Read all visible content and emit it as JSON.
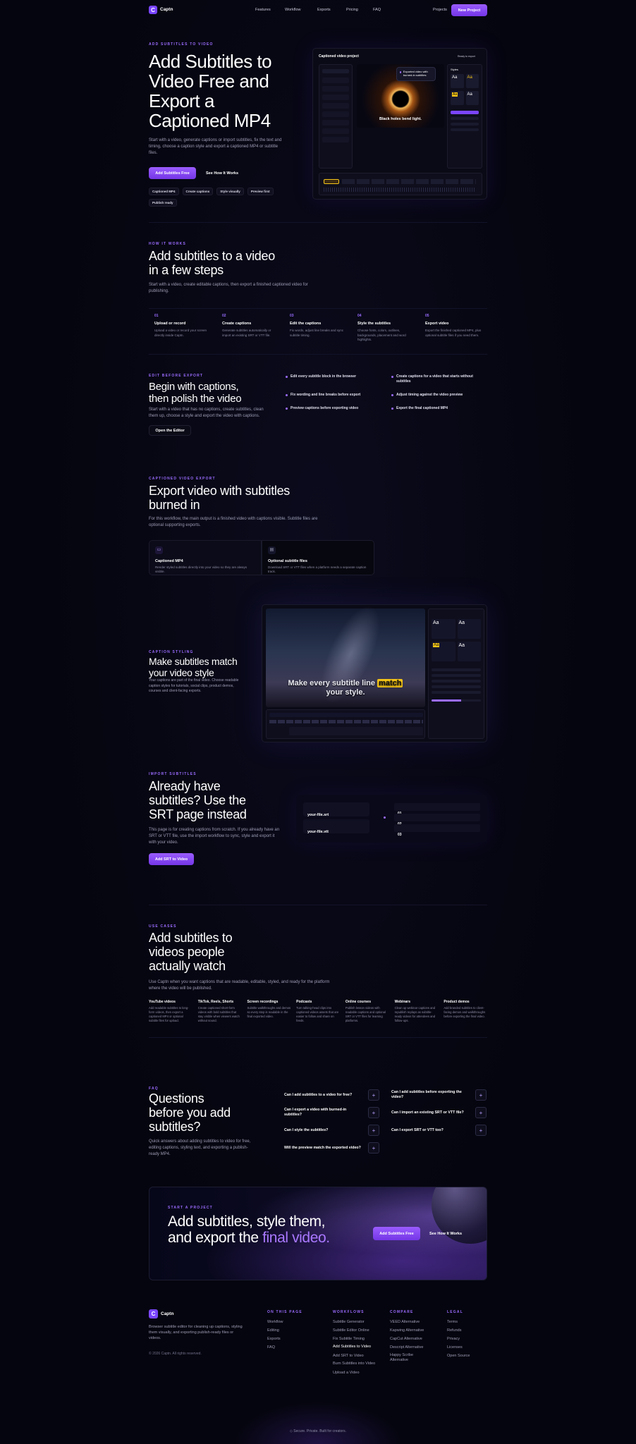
{
  "nav": {
    "brand": "Captn",
    "links": [
      "Features",
      "Workflow",
      "Exports",
      "Pricing",
      "FAQ"
    ],
    "projects": "Projects",
    "new_project": "New Project"
  },
  "hero": {
    "eyebrow": "ADD SUBTITLES TO VIDEO",
    "title": "Add Subtitles to Video Free and Export a Captioned MP4",
    "desc": "Start with a video, generate captions or import subtitles, fix the text and timing, choose a caption style and export a captioned MP4 or subtitle files.",
    "cta_primary": "Add Subtitles Free",
    "cta_secondary": "See How It Works",
    "chips": [
      "Captioned MP4",
      "Create captions",
      "Style visually",
      "Preview first",
      "Publish ready"
    ]
  },
  "editor": {
    "title": "Captioned video project",
    "status": "Ready to export",
    "caption": "Black holes bend light.",
    "tooltip": "Exported video with burned-in subtitles",
    "tab": "Styles"
  },
  "steps": {
    "eyebrow": "HOW IT WORKS",
    "title": "Add subtitles to a video in a few steps",
    "desc": "Start with a video, create editable captions, then export a finished captioned video for publishing.",
    "items": [
      {
        "num": "01",
        "title": "Upload or record",
        "desc": "Upload a video or record your screen directly inside Captn."
      },
      {
        "num": "02",
        "title": "Create captions",
        "desc": "Generate subtitles automatically or import an existing SRT or VTT file."
      },
      {
        "num": "03",
        "title": "Edit the captions",
        "desc": "Fix words, adjust line breaks and sync subtitle timing."
      },
      {
        "num": "04",
        "title": "Style the subtitles",
        "desc": "Choose fonts, colors, outlines, backgrounds, placement and word highlights."
      },
      {
        "num": "05",
        "title": "Export video",
        "desc": "Export the finished captioned MP4, plus optional subtitle files if you need them."
      }
    ]
  },
  "edit": {
    "eyebrow": "EDIT BEFORE EXPORT",
    "title": "Begin with captions, then polish the video",
    "desc": "Start with a video that has no captions, create subtitles, clean them up, choose a style and export the video with captions.",
    "button": "Open the Editor",
    "features": [
      "Edit every subtitle block in the browser",
      "Create captions for a video that starts without subtitles",
      "Fix wording and line breaks before export",
      "Adjust timing against the video preview",
      "Preview captions before exporting video",
      "Export the final captioned MP4"
    ]
  },
  "export": {
    "eyebrow": "CAPTIONED VIDEO EXPORT",
    "title": "Export video with subtitles burned in",
    "desc": "For this workflow, the main output is a finished video with captions visible. Subtitle files are optional supporting exports.",
    "cards": [
      {
        "title": "Captioned MP4",
        "desc": "Render styled subtitles directly into your video so they are always visible."
      },
      {
        "title": "Optional subtitle files",
        "desc": "Download SRT or VTT files when a platform needs a separate caption track."
      }
    ]
  },
  "styling": {
    "eyebrow": "CAPTION STYLING",
    "title": "Make subtitles match your video style",
    "desc": "Your captions are part of the final video. Choose readable caption styles for tutorials, social clips, product demos, courses and client-facing exports.",
    "preview_text": "Make every subtitle line",
    "preview_hl": "match",
    "preview_text2": "your style."
  },
  "srt": {
    "eyebrow": "IMPORT SUBTITLES",
    "title": "Already have subtitles? Use the SRT page instead",
    "desc": "This page is for creating captions from scratch. If you already have an SRT or VTT file, use the import workflow to sync, style and export it with your video.",
    "button": "Add SRT to Video",
    "files": [
      "your-file.srt",
      "your-file.vtt"
    ],
    "rows": [
      "01",
      "02",
      "03"
    ]
  },
  "usecases": {
    "eyebrow": "USE CASES",
    "title": "Add subtitles to videos people actually watch",
    "desc": "Use Captn when you want captions that are readable, editable, styled, and ready for the platform where the video will be published.",
    "items": [
      {
        "title": "YouTube videos",
        "desc": "Add readable subtitles to long-form videos, then export a captioned MP4 or optional subtitle files for upload."
      },
      {
        "title": "TikTok, Reels, Shorts",
        "desc": "Create captioned short-form videos with bold subtitles that stay visible when viewers watch without sound."
      },
      {
        "title": "Screen recordings",
        "desc": "Subtitle walkthroughs and demos so every step is readable in the final exported video."
      },
      {
        "title": "Podcasts",
        "desc": "Turn talking-head clips into captioned videos assets that are easier to follow and share on feeds."
      },
      {
        "title": "Online courses",
        "desc": "Publish lesson videos with readable captions and optional SRT or VTT files for learning platforms."
      },
      {
        "title": "Webinars",
        "desc": "Clean up webinar captions and republish replays as subtitle-ready videos for attendees and follow-ups."
      },
      {
        "title": "Product demos",
        "desc": "Add branded subtitles to client-facing demos and walkthroughs before exporting the final video."
      }
    ]
  },
  "faq": {
    "eyebrow": "FAQ",
    "title": "Questions before you add subtitles?",
    "desc": "Quick answers about adding subtitles to video for free, editing captions, styling text, and exporting a publish-ready MP4.",
    "left": [
      "Can I add subtitles to a video for free?",
      "Can I export a video with burned-in subtitles?",
      "Can I style the subtitles?",
      "Will the preview match the exported video?"
    ],
    "right": [
      "Can I add subtitles before exporting the video?",
      "Can I import an existing SRT or VTT file?",
      "Can I export SRT or VTT too?"
    ]
  },
  "cta": {
    "eyebrow": "START A PROJECT",
    "title_a": "Add subtitles, style them, and export the ",
    "title_hl": "final video.",
    "primary": "Add Subtitles Free",
    "secondary": "See How It Works"
  },
  "footer": {
    "brand": "Captn",
    "desc": "Browser subtitle editor for cleaning up captions, styling them visually, and exporting publish-ready files or videos.",
    "copyright": "© 2026 Captn. All rights reserved.",
    "cols": [
      {
        "h": "ON THIS PAGE",
        "l": [
          "Workflow",
          "Editing",
          "Exports",
          "FAQ"
        ]
      },
      {
        "h": "WORKFLOWS",
        "l": [
          "Subtitle Generator",
          "Subtitle Editor Online",
          "Fix Subtitle Timing",
          "Add Subtitles to Video",
          "Add SRT to Video",
          "Burn Subtitles into Video",
          "Upload a Video"
        ]
      },
      {
        "h": "COMPARE",
        "l": [
          "VEED Alternative",
          "Kapwing Alternative",
          "CapCut Alternative",
          "Descript Alternative",
          "Happy Scribe Alternative"
        ]
      },
      {
        "h": "LEGAL",
        "l": [
          "Terms",
          "Refunds",
          "Privacy",
          "Licenses",
          "Open Source"
        ]
      }
    ],
    "tagline": "Secure. Private. Built for creators."
  },
  "colors": {
    "accent": "#9b6cff",
    "bg": "#05050f",
    "highlight": "#f5c518"
  }
}
